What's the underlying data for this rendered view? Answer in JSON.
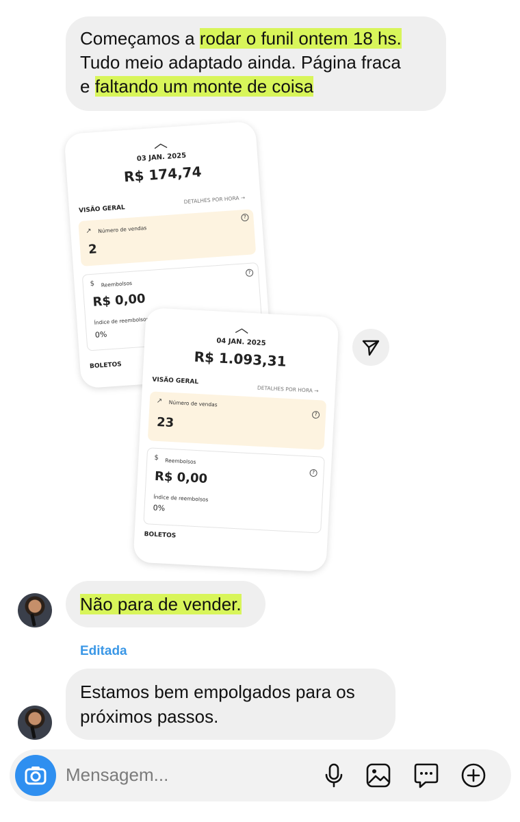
{
  "messages": [
    {
      "text_segments": [
        "Começamos a ",
        "rodar o funil ontem 18 hs.",
        "Tudo meio adaptado ainda. Página fraca",
        "e ",
        "faltando um monte de coisa"
      ]
    },
    {
      "text": "Não para de vender."
    },
    {
      "label": "Editada",
      "text": [
        "Estamos bem empolgados para os",
        "próximos passos."
      ]
    }
  ],
  "screenshot_card_1": {
    "date": "03 JAN. 2025",
    "total": "R$ 174,74",
    "overview": "VISÃO GERAL",
    "details": "DETALHES POR HORA",
    "sales_label": "Número de vendas",
    "sales_value": "2",
    "refunds_label": "Reembolsos",
    "refunds_value": "R$ 0,00",
    "refund_rate_label": "Índice de reembolsos",
    "refund_rate_value": "0%",
    "boletos": "BOLETOS"
  },
  "screenshot_card_2": {
    "date": "04 JAN. 2025",
    "total": "R$ 1.093,31",
    "overview": "VISÃO GERAL",
    "details": "DETALHES POR HORA",
    "sales_label": "Número de vendas",
    "sales_value": "23",
    "refunds_label": "Reembolsos",
    "refunds_value": "R$ 0,00",
    "refund_rate_label": "Índice de reembolsos",
    "refund_rate_value": "0%",
    "boletos": "BOLETOS"
  },
  "composer": {
    "placeholder": "Mensagem...",
    "icons": [
      "camera-icon",
      "microphone-icon",
      "image-icon",
      "sticker-icon",
      "plus-icon"
    ]
  },
  "colors": {
    "highlight": "#d8f55a",
    "bubble": "#efefef",
    "accent": "#2f8ff0",
    "edited": "#3a97e6"
  }
}
